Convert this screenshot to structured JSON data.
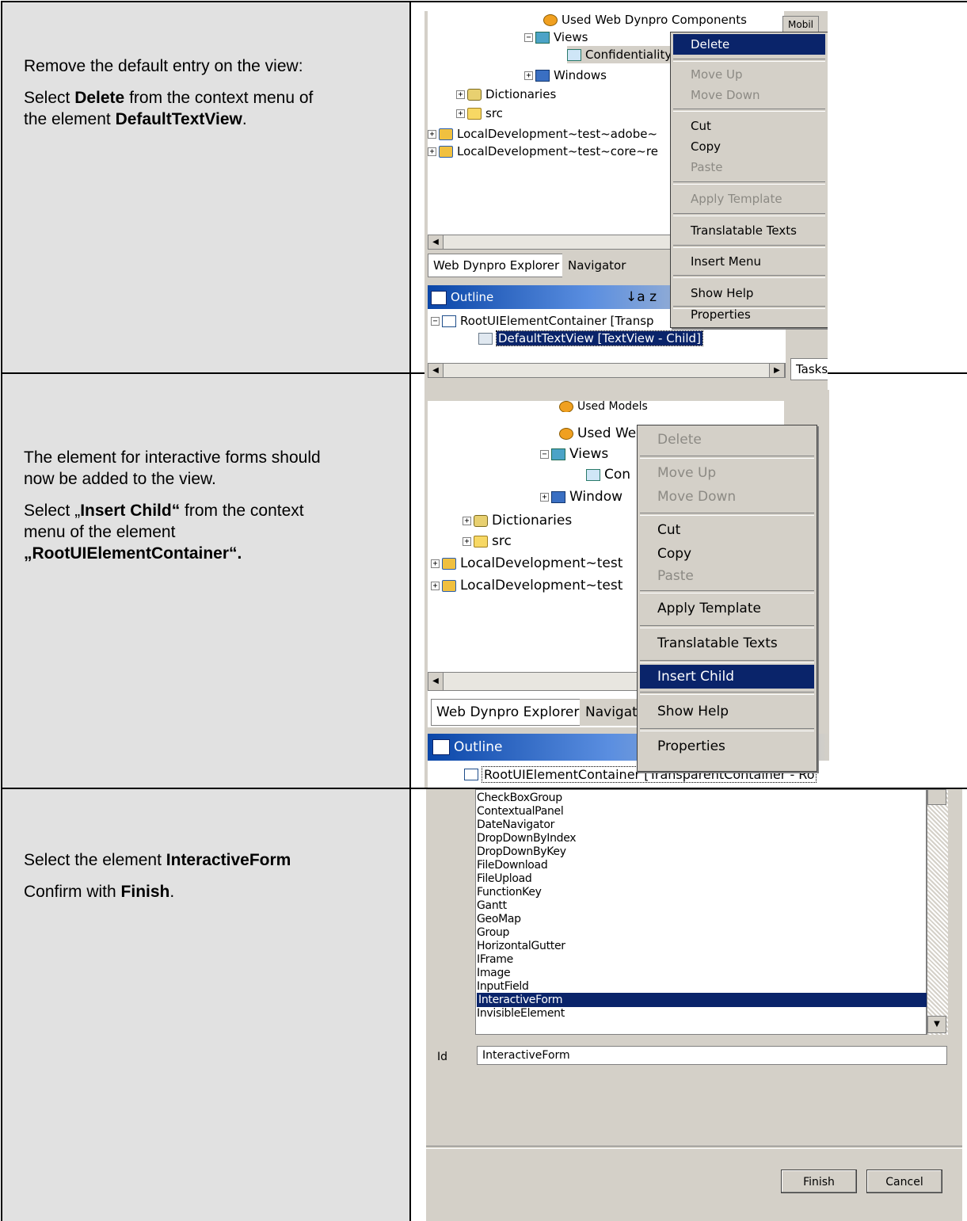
{
  "rows": [
    {
      "lines": [
        {
          "parts": [
            "Remove the default entry on the view:"
          ]
        },
        {
          "parts": [
            "Select ",
            "Delete",
            " from the context menu of"
          ]
        },
        {
          "parts": [
            "the element ",
            "DefaultTextView",
            "."
          ]
        }
      ]
    },
    {
      "lines": [
        {
          "parts": [
            "The element for interactive forms should"
          ]
        },
        {
          "parts": [
            "now be added to the view."
          ]
        },
        {
          "parts": [
            "Select „",
            "Insert Child“",
            " from the context"
          ]
        },
        {
          "parts": [
            "menu of the element"
          ]
        },
        {
          "parts": [
            "„",
            "RootUIElementContainer“."
          ]
        }
      ]
    },
    {
      "lines": [
        {
          "parts": [
            "Select the element ",
            "InteractiveForm"
          ]
        },
        {
          "parts": [
            "Confirm with ",
            "Finish",
            "."
          ]
        }
      ]
    }
  ],
  "shot1": {
    "tree": [
      "Used Web Dynpro Components",
      "Views",
      "Confidentiality",
      "Windows",
      "Dictionaries",
      "src",
      "LocalDevelopment~test~adobe~",
      "LocalDevelopment~test~core~re"
    ],
    "right_tab": "Mobil",
    "menu": {
      "delete": "Delete",
      "move_up": "Move Up",
      "move_down": "Move Down",
      "cut": "Cut",
      "copy": "Copy",
      "paste": "Paste",
      "apply_template": "Apply Template",
      "translatable_texts": "Translatable Texts",
      "insert_menu": "Insert Menu",
      "show_help": "Show Help",
      "properties": "Properties"
    },
    "tabs": {
      "explorer": "Web Dynpro Explorer",
      "navigator": "Navigator"
    },
    "outline": {
      "title": "Outline",
      "sort_glyph": "↓a z"
    },
    "outline_items": [
      "RootUIElementContainer [Transp",
      "DefaultTextView [TextView - Child]"
    ],
    "tasks_tab": "Tasks"
  },
  "shot2": {
    "tree": [
      "Used Models",
      "Used We",
      "Views",
      "Con",
      "Window",
      "Dictionaries",
      "src",
      "LocalDevelopment~test",
      "LocalDevelopment~test"
    ],
    "menu": {
      "delete": "Delete",
      "move_up": "Move Up",
      "move_down": "Move Down",
      "cut": "Cut",
      "copy": "Copy",
      "paste": "Paste",
      "apply_template": "Apply Template",
      "translatable_texts": "Translatable Texts",
      "insert_child": "Insert Child",
      "show_help": "Show Help",
      "properties": "Properties"
    },
    "tabs": {
      "explorer": "Web Dynpro Explorer",
      "navigator": "Navigato"
    },
    "outline": {
      "title": "Outline"
    },
    "outline_items": [
      "RootUIElementContainer [TransparentContainer - Ro"
    ]
  },
  "shot3": {
    "list": [
      "CheckBoxGroup",
      "ContextualPanel",
      "DateNavigator",
      "DropDownByIndex",
      "DropDownByKey",
      "FileDownload",
      "FileUpload",
      "FunctionKey",
      "Gantt",
      "GeoMap",
      "Group",
      "HorizontalGutter",
      "IFrame",
      "Image",
      "InputField",
      "InteractiveForm",
      "InvisibleElement"
    ],
    "selected_index": 15,
    "id_label": "Id",
    "id_value": "InteractiveForm",
    "finish": "Finish",
    "cancel": "Cancel"
  }
}
